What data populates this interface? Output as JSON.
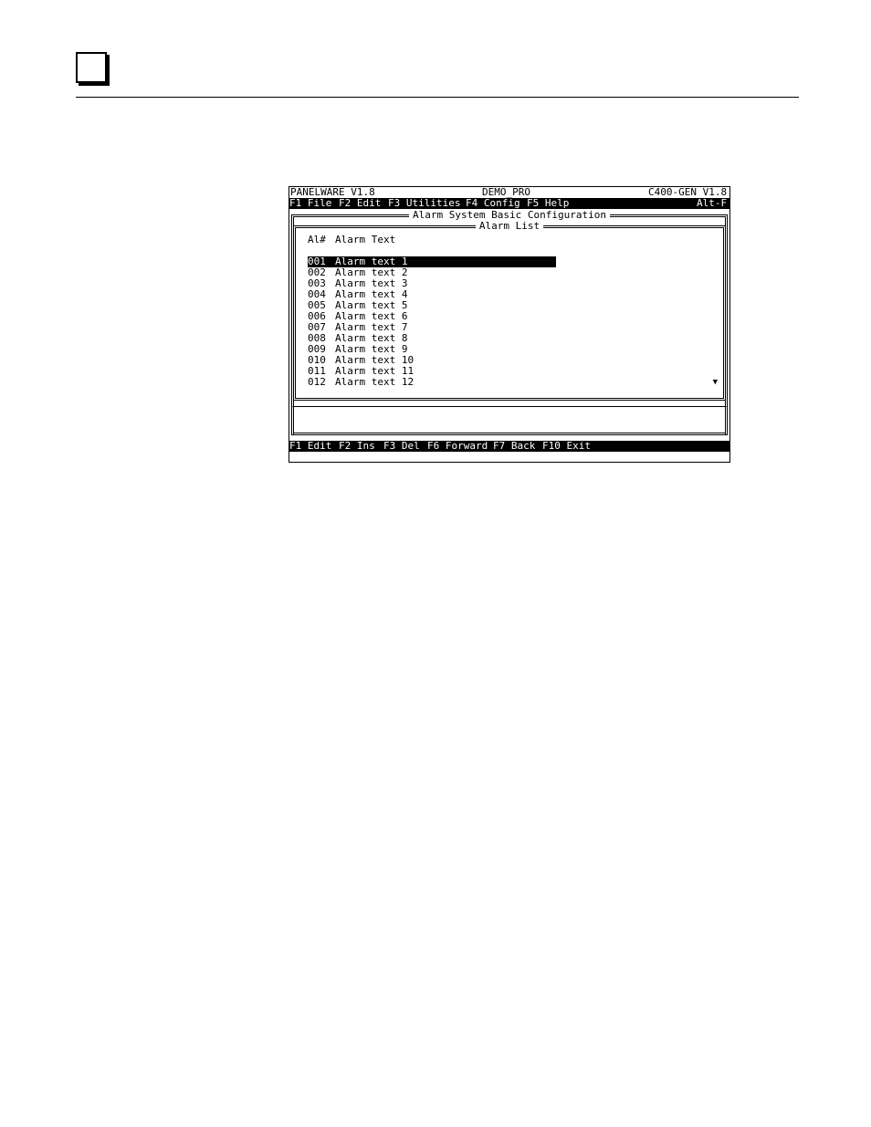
{
  "header": {
    "title_left": "PANELWARE V1.8",
    "title_center": "DEMO_PRO",
    "title_right": "C400-GEN V1.8"
  },
  "menu": {
    "items": [
      "F1 File",
      "F2 Edit",
      "F3 Utilities",
      "F4 Config",
      "F5 Help"
    ],
    "shortcut": "Alt-F"
  },
  "window": {
    "title": "Alarm System Basic Configuration"
  },
  "list": {
    "title": "Alarm List",
    "col_num": "Al#",
    "col_text": "Alarm Text",
    "rows": [
      {
        "num": "001",
        "text": "Alarm text 1",
        "selected": true
      },
      {
        "num": "002",
        "text": "Alarm text 2"
      },
      {
        "num": "003",
        "text": "Alarm text 3"
      },
      {
        "num": "004",
        "text": "Alarm text 4"
      },
      {
        "num": "005",
        "text": "Alarm text 5"
      },
      {
        "num": "006",
        "text": "Alarm text 6"
      },
      {
        "num": "007",
        "text": "Alarm text 7"
      },
      {
        "num": "008",
        "text": "Alarm text 8"
      },
      {
        "num": "009",
        "text": "Alarm text 9"
      },
      {
        "num": "010",
        "text": "Alarm text 10"
      },
      {
        "num": "011",
        "text": "Alarm text 11"
      },
      {
        "num": "012",
        "text": "Alarm text 12"
      }
    ],
    "scroll_icon": "▼"
  },
  "fkeys": [
    "F1 Edit",
    "F2 Ins",
    "F3 Del",
    "F6 Forward",
    "F7 Back",
    "F10 Exit"
  ]
}
